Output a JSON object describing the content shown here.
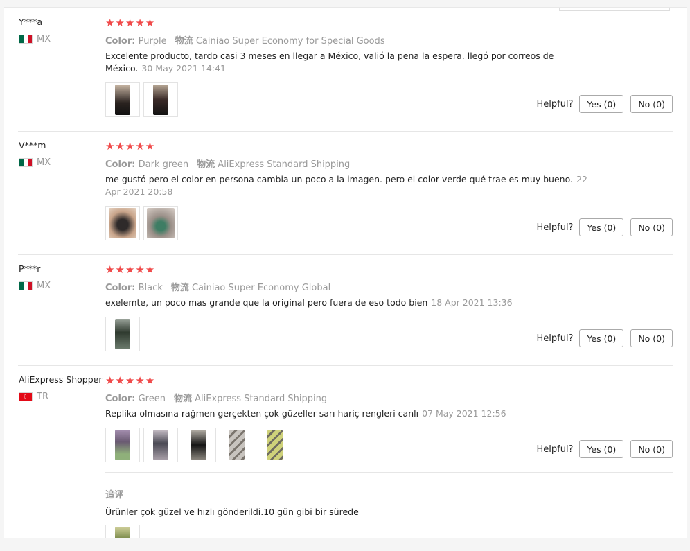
{
  "helpful_label": "Helpful?",
  "colors": {
    "star": "#f04a4a",
    "muted": "#999999",
    "text": "#222222",
    "border": "#e6e6e6"
  },
  "reviews": [
    {
      "user": "Y***a",
      "country_code": "MX",
      "flag": "mexico-flag",
      "stars": "★★★★★",
      "rating": 5,
      "color_label": "Color:",
      "color_value": "Purple",
      "shipping_label": "物流",
      "shipping_value": "Cainiao Super Economy for Special Goods",
      "text": "Excelente producto, tardo casi 3 meses en llegar a México, valió la pena la espera. llegó por correos de México.",
      "date": "30 May 2021 14:41",
      "photo_count": 2,
      "yes_label": "Yes (0)",
      "no_label": "No (0)"
    },
    {
      "user": "V***m",
      "country_code": "MX",
      "flag": "mexico-flag",
      "stars": "★★★★★",
      "rating": 5,
      "color_label": "Color:",
      "color_value": "Dark green",
      "shipping_label": "物流",
      "shipping_value": "AliExpress Standard Shipping",
      "text": "me gustó pero el color en persona cambia un poco a la imagen. pero el color verde qué trae es muy bueno.",
      "date": "22 Apr 2021 20:58",
      "photo_count": 2,
      "yes_label": "Yes (0)",
      "no_label": "No (0)"
    },
    {
      "user": "P***r",
      "country_code": "MX",
      "flag": "mexico-flag",
      "stars": "★★★★★",
      "rating": 5,
      "color_label": "Color:",
      "color_value": "Black",
      "shipping_label": "物流",
      "shipping_value": "Cainiao Super Economy Global",
      "text": "exelemte, un poco mas grande que la original pero fuera de eso todo bien",
      "date": "18 Apr 2021 13:36",
      "photo_count": 1,
      "yes_label": "Yes (0)",
      "no_label": "No (0)"
    },
    {
      "user": "AliExpress Shopper",
      "country_code": "TR",
      "flag": "turkey-flag",
      "stars": "★★★★★",
      "rating": 5,
      "color_label": "Color:",
      "color_value": "Green",
      "shipping_label": "物流",
      "shipping_value": "AliExpress Standard Shipping",
      "text": "Replika olmasına rağmen gerçekten çok güzeller sarı hariç rengleri canlı",
      "date": "07 May 2021 12:56",
      "photo_count": 5,
      "yes_label": "Yes (0)",
      "no_label": "No (0)",
      "followup_title": "追评",
      "followup_text": "Ürünler çok güzel ve hızlı gönderildi.10 gün gibi bir sürede",
      "followup_photo_count": 1
    }
  ]
}
